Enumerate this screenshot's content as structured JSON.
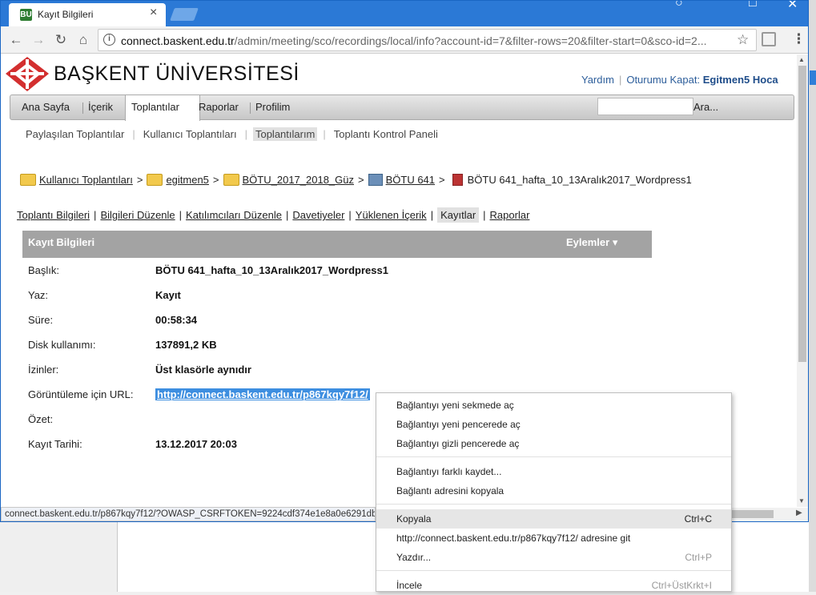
{
  "browser": {
    "tab_title": "Kayıt Bilgileri",
    "tab_favicon": "BU",
    "tab_close": "×",
    "url_host": "connect.baskent.edu.tr",
    "url_path": "/admin/meeting/sco/recordings/local/info?account-id=7&filter-rows=20&filter-start=0&sco-id=2...",
    "status_url": "connect.baskent.edu.tr/p867kqy7f12/?OWASP_CSRFTOKEN=9224cdf374e1e8a0e6291db"
  },
  "header": {
    "brand": "BAŞKENT  ÜNİVERSİTESİ",
    "help": "Yardım",
    "logout": "Oturumu Kapat:",
    "user": "Egitmen5 Hoca"
  },
  "main_nav": {
    "items": [
      "Ana Sayfa",
      "İçerik",
      "Toplantılar",
      "Raporlar",
      "Profilim"
    ],
    "search_button": "Ara..."
  },
  "sub_nav": [
    "Paylaşılan Toplantılar",
    "Kullanıcı Toplantıları",
    "Toplantılarım",
    "Toplantı Kontrol Paneli"
  ],
  "breadcrumb": [
    "Kullanıcı Toplantıları",
    "egitmen5",
    "BÖTU_2017_2018_Güz",
    "BÖTU 641",
    "BÖTU 641_hafta_10_13Aralık2017_Wordpress1"
  ],
  "meeting_tabs": [
    "Toplantı Bilgileri",
    "Bilgileri Düzenle",
    "Katılımcıları Düzenle",
    "Davetiyeler",
    "Yüklenen İçerik",
    "Kayıtlar",
    "Raporlar"
  ],
  "panel": {
    "title": "Kayıt Bilgileri",
    "actions": "Eylemler ▾"
  },
  "fields": [
    {
      "label": "Başlık:",
      "value": "BÖTU 641_hafta_10_13Aralık2017_Wordpress1"
    },
    {
      "label": "Yaz:",
      "value": "Kayıt"
    },
    {
      "label": "Süre:",
      "value": "00:58:34"
    },
    {
      "label": "Disk kullanımı:",
      "value": "137891,2 KB"
    },
    {
      "label": "İzinler:",
      "value": "Üst klasörle aynıdır"
    },
    {
      "label": "Görüntüleme için URL:",
      "value": "http://connect.baskent.edu.tr/p867kqy7f12/"
    },
    {
      "label": "Özet:",
      "value": ""
    },
    {
      "label": "Kayıt Tarihi:",
      "value": "13.12.2017 20:03"
    }
  ],
  "context_menu": {
    "open_new_tab": "Bağlantıyı yeni sekmede aç",
    "open_new_window": "Bağlantıyı yeni pencerede aç",
    "open_incognito": "Bağlantıyı gizli pencerede aç",
    "save_link_as": "Bağlantıyı farklı kaydet...",
    "copy_link_address": "Bağlantı adresini kopyala",
    "copy": "Kopyala",
    "copy_shortcut": "Ctrl+C",
    "go_to": "http://connect.baskent.edu.tr/p867kqy7f12/ adresine git",
    "print": "Yazdır...",
    "print_shortcut": "Ctrl+P",
    "inspect": "İncele",
    "inspect_shortcut": "Ctrl+ÜstKrkt+I"
  }
}
